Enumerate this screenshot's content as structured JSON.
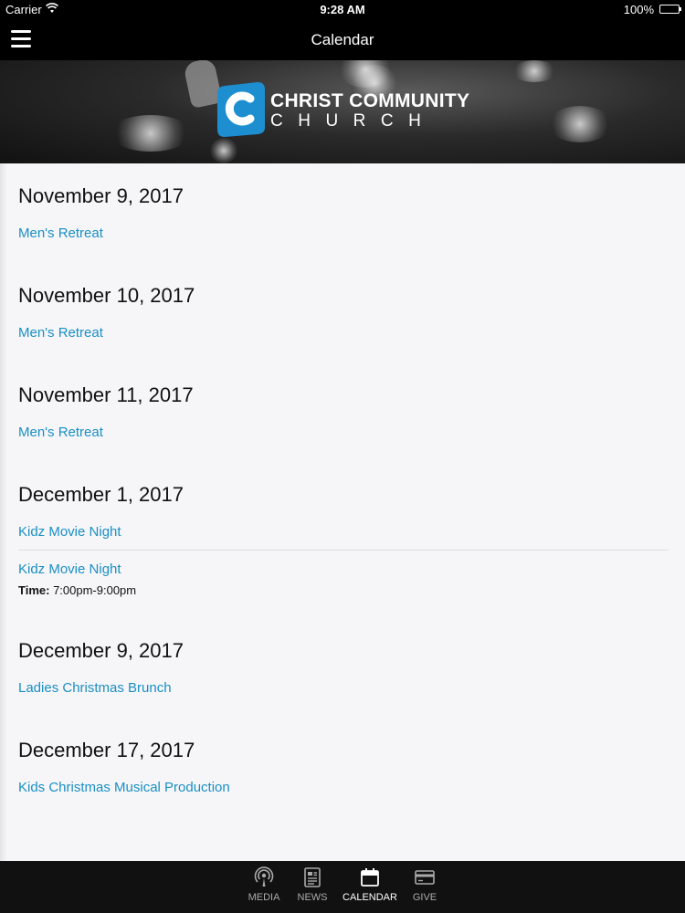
{
  "status_bar": {
    "carrier": "Carrier",
    "time": "9:28 AM",
    "battery": "100%"
  },
  "nav": {
    "title": "Calendar",
    "menu_icon": "hamburger-menu-icon"
  },
  "banner": {
    "logo_line1": "CHRIST COMMUNITY",
    "logo_line2": "CHURCH",
    "logo_colors": [
      "#1d8fd0",
      "#ffffff"
    ]
  },
  "days": [
    {
      "date": "November 9, 2017",
      "events": [
        {
          "title": "Men's Retreat"
        }
      ]
    },
    {
      "date": "November 10, 2017",
      "events": [
        {
          "title": "Men's Retreat"
        }
      ]
    },
    {
      "date": "November 11, 2017",
      "events": [
        {
          "title": "Men's Retreat"
        }
      ]
    },
    {
      "date": "December 1, 2017",
      "events": [
        {
          "title": "Kidz Movie Night"
        },
        {
          "title": "Kidz Movie Night",
          "time_label": "Time:",
          "time_value": "7:00pm-9:00pm"
        }
      ]
    },
    {
      "date": "December 9, 2017",
      "events": [
        {
          "title": "Ladies Christmas Brunch"
        }
      ]
    },
    {
      "date": "December 17, 2017",
      "events": [
        {
          "title": "Kids Christmas Musical Production"
        }
      ]
    }
  ],
  "tabs": [
    {
      "label": "MEDIA",
      "icon": "podcast-icon",
      "active": false
    },
    {
      "label": "NEWS",
      "icon": "news-icon",
      "active": false
    },
    {
      "label": "CALENDAR",
      "icon": "calendar-icon",
      "active": true
    },
    {
      "label": "GIVE",
      "icon": "credit-card-icon",
      "active": false
    }
  ],
  "colors": {
    "link": "#1a8fc4",
    "bar_background": "#000000",
    "content_background": "#f6f6f8"
  }
}
